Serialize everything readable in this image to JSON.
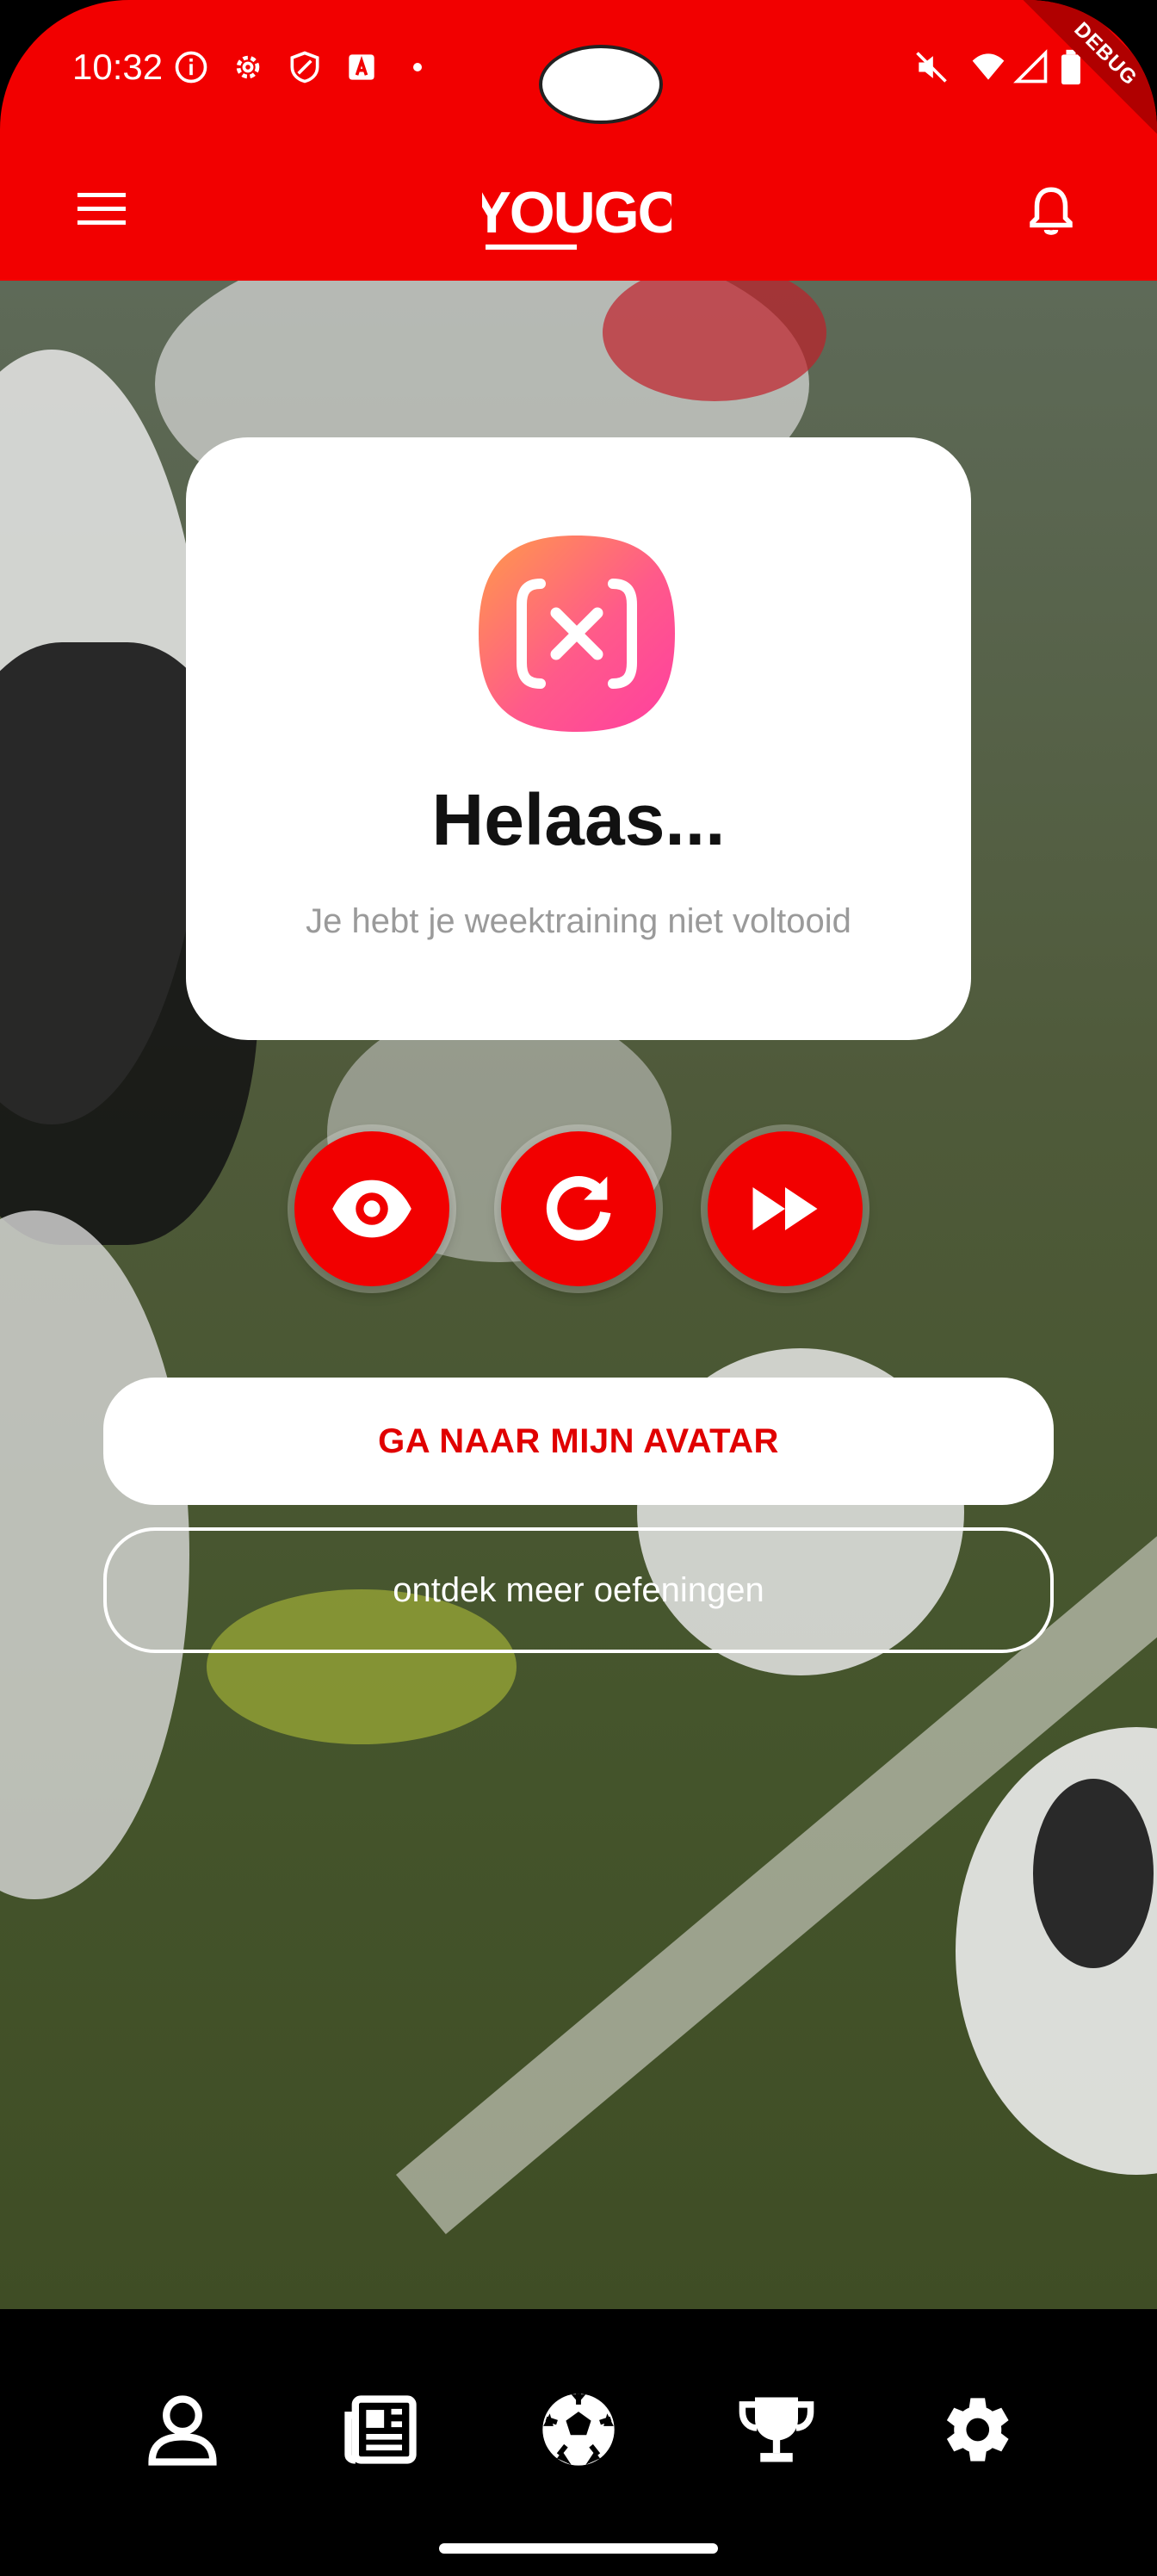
{
  "status_bar": {
    "time": "10:32",
    "icons": [
      "info-icon",
      "settings-icon",
      "shield-icon",
      "a-icon",
      "dot-icon",
      "mute-icon",
      "wifi-icon",
      "signal-icon",
      "battery-icon"
    ],
    "debug_label": "DEBUG"
  },
  "app_bar": {
    "logo_text": "YOUGO",
    "icons": [
      "menu-icon",
      "bell-icon"
    ]
  },
  "card": {
    "title": "Helaas...",
    "subtitle": "Je hebt je weektraining niet voltooid"
  },
  "actions": {
    "icons": [
      "eye-icon",
      "refresh-icon",
      "fast-forward-icon"
    ]
  },
  "buttons": {
    "primary_label": "GA NAAR MIJN AVATAR",
    "secondary_label": "ontdek meer oefeningen"
  },
  "bottom_nav": {
    "items": [
      "profile-icon",
      "news-icon",
      "football-icon",
      "trophy-icon",
      "settings-icon"
    ]
  },
  "colors": {
    "brand_red": "#f20000",
    "card_bg": "#ffffff",
    "nav_bg": "#000000"
  }
}
